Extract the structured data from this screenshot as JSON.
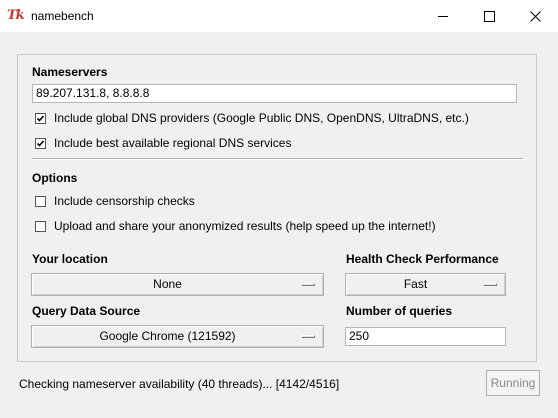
{
  "window": {
    "title": "namebench",
    "icon_text": "Tk"
  },
  "nameservers": {
    "heading": "Nameservers",
    "value": "89.207.131.8, 8.8.8.8",
    "include_global_label": "Include global DNS providers (Google Public DNS, OpenDNS, UltraDNS, etc.)",
    "include_global_checked": true,
    "include_regional_label": "Include best available regional DNS services",
    "include_regional_checked": true
  },
  "options": {
    "heading": "Options",
    "censorship_label": "Include censorship checks",
    "censorship_checked": false,
    "upload_label": "Upload and share your anonymized results (help speed up the internet!)",
    "upload_checked": false
  },
  "location": {
    "heading": "Your location",
    "selected": "None"
  },
  "health_check": {
    "heading": "Health Check Performance",
    "selected": "Fast"
  },
  "query_source": {
    "heading": "Query Data Source",
    "selected": "Google Chrome (121592)"
  },
  "num_queries": {
    "heading": "Number of queries",
    "value": "250"
  },
  "status": {
    "text": "Checking nameserver availability (40 threads)... [4142/4516]"
  },
  "run_button": {
    "label": "Running",
    "disabled": true
  }
}
